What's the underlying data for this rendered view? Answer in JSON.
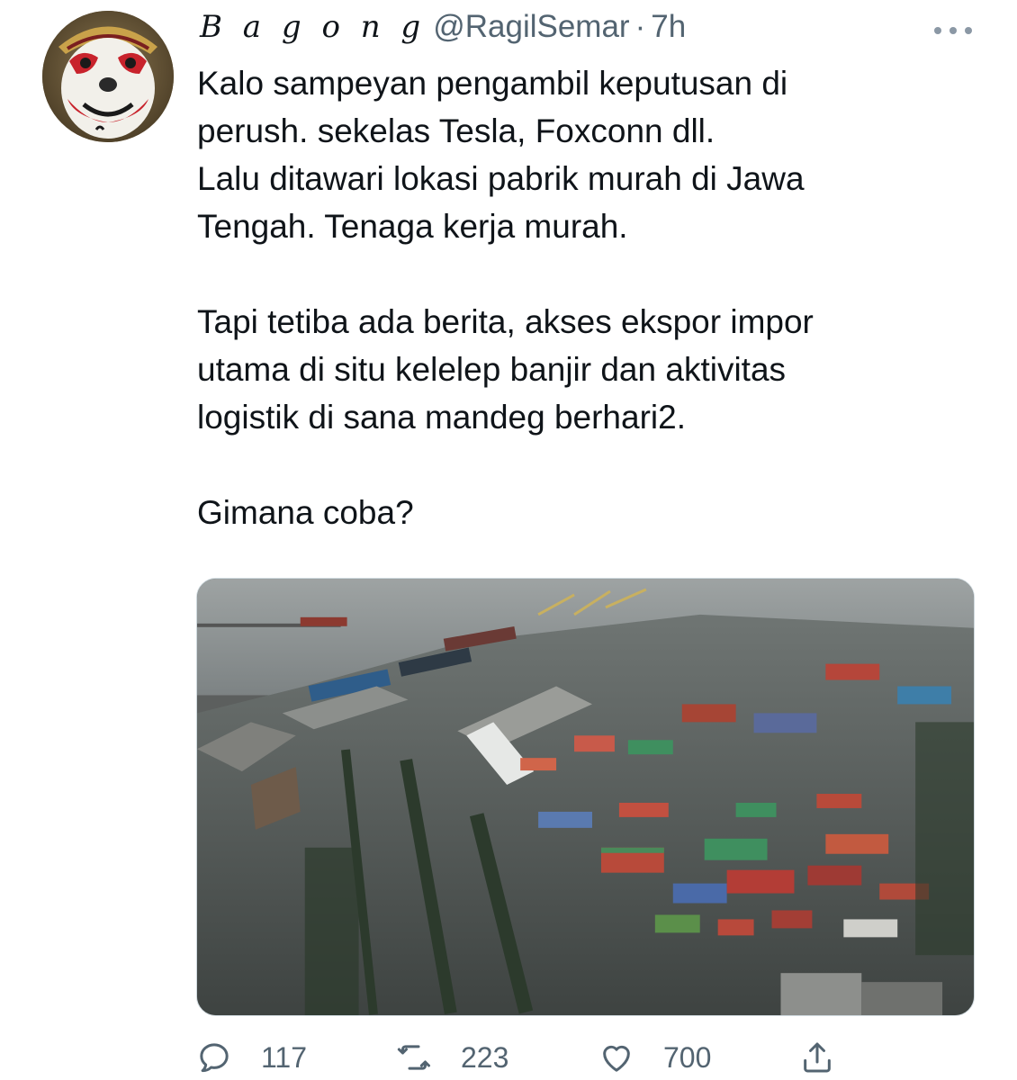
{
  "author": {
    "display_name": "B a g o n g",
    "handle": "@RagilSemar",
    "separator": "·",
    "time": "7h"
  },
  "tweet": {
    "paragraphs": [
      [
        "Kalo sampeyan pengambil keputusan di",
        "perush. sekelas Tesla, Foxconn dll.",
        "Lalu ditawari lokasi pabrik murah di Jawa",
        "Tengah. Tenaga kerja murah."
      ],
      [
        "Tapi tetiba ada berita, akses ekspor impor",
        "utama di situ kelelep banjir dan aktivitas",
        "logistik di sana mandeg berhari2."
      ],
      [
        "Gimana coba?"
      ]
    ]
  },
  "actions": {
    "reply": {
      "icon": "reply-icon",
      "count": "117"
    },
    "retweet": {
      "icon": "retweet-icon",
      "count": "223"
    },
    "like": {
      "icon": "heart-icon",
      "count": "700"
    },
    "share": {
      "icon": "share-icon"
    }
  },
  "colors": {
    "text": "#0f1419",
    "secondary": "#536471",
    "border": "#cfd9de"
  }
}
